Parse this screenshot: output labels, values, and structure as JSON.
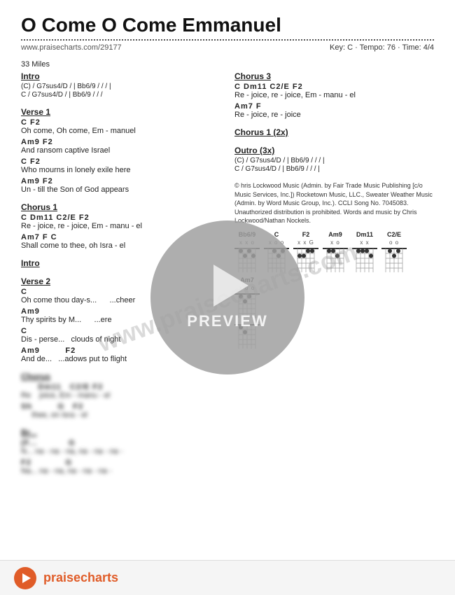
{
  "page": {
    "title": "O Come O Come Emmanuel",
    "url": "www.praisecharts.com/29177",
    "artist": "33 Miles",
    "key_info": "Key: C · Tempo: 76 · Time: 4/4"
  },
  "sections": {
    "intro": {
      "title": "Intro",
      "lines": [
        "(C) / G7sus4/D / | Bb6/9 / / / |",
        "C / G7sus4/D / | Bb6/9 / / /"
      ]
    },
    "verse1": {
      "title": "Verse 1",
      "chord_lyric_pairs": [
        {
          "chords": "C                 F2",
          "lyrics": "Oh come, Oh come, Em - manuel"
        },
        {
          "chords": "Am9              F2",
          "lyrics": "And ransom captive Israel"
        },
        {
          "chords": "C                 F2",
          "lyrics": "Who mourns in lonely exile here"
        },
        {
          "chords": "Am9              F2",
          "lyrics": "Un - till  the Son of God appears"
        }
      ]
    },
    "chorus1": {
      "title": "Chorus 1",
      "chord_lyric_pairs": [
        {
          "chords": "C       Dm11      C2/E  F2",
          "lyrics": "Re - joice, re - joice, Em - manu - el"
        },
        {
          "chords": "Am7          F         C",
          "lyrics": "Shall come to thee, oh Isra - el"
        }
      ]
    },
    "intro2": {
      "title": "Intro"
    },
    "verse2": {
      "title": "Verse 2",
      "chord_lyric_pairs": [
        {
          "chords": "C",
          "lyrics": "Oh come thou day-s...      ...cheer"
        },
        {
          "chords": "Am9",
          "lyrics": "Thy spirits by M...      ...ere"
        },
        {
          "chords": "C",
          "lyrics": "Dis - perse...   clouds of night"
        },
        {
          "chords": "Am9         F2",
          "lyrics": "And de...   ...adows put to flight"
        }
      ]
    },
    "chorus2_blurred": {
      "title": "Chorus",
      "chord_lyric_pairs": [
        {
          "chords": "      Dm11   C2/E  F2",
          "lyrics": "Re    joice, Em - manu - el"
        },
        {
          "chords": "Sh         G   F2",
          "lyrics": "     thee, on Isra - el"
        }
      ]
    },
    "bridge_blurred": {
      "title": "Br...",
      "chord_lyric_pairs": [
        {
          "chords": "(F...           G",
          "lyrics": "N... na - na - na, na - na - na -"
        },
        {
          "chords": "F2            G",
          "lyrics": "Na... na - na, na - na - na -"
        }
      ]
    },
    "chorus3": {
      "title": "Chorus 3",
      "chord_lyric_pairs": [
        {
          "chords": "C         Dm11     C2/E  F2",
          "lyrics": "Re - joice, re - joice, Em - manu - el"
        },
        {
          "chords": "Am7         F",
          "lyrics": "Re - joice, re - joice"
        }
      ]
    },
    "chorus1_2x": {
      "title": "Chorus 1 (2x)"
    },
    "outro": {
      "title": "Outro (3x)",
      "lines": [
        "(C) / G7sus4/D / | Bb6/9 / / / |",
        "C / G7sus4/D / | Bb6/9 / / / |"
      ]
    }
  },
  "copyright": "© hris Lockwood Music (Admin. by Fair Trade Music Publishing [c/o Music Services, Inc.]) Rocketown Music, LLC., Sweater Weather Music (Admin. by Word Music Group, Inc.). CCLI Song No. 7045083. Unauthorized distribution is prohibited. Words and music by Chris Lockwood/Nathan Nockels.",
  "chord_diagrams": [
    {
      "name": "Bb6/9",
      "markers": "x x o"
    },
    {
      "name": "C",
      "markers": "x o o"
    },
    {
      "name": "F2",
      "markers": "x x G"
    },
    {
      "name": "Am9",
      "markers": "x o"
    },
    {
      "name": "Dm11",
      "markers": "x x"
    },
    {
      "name": "C2/E",
      "markers": "o o"
    },
    {
      "name": "Am7",
      "markers": "x o o"
    }
  ],
  "bottom_bar": {
    "logo_prefix": "pr",
    "logo_accent": "ai",
    "logo_suffix": "secharts"
  },
  "preview": {
    "label": "PREVIEW"
  },
  "watermark": "www.praisecharts.com"
}
